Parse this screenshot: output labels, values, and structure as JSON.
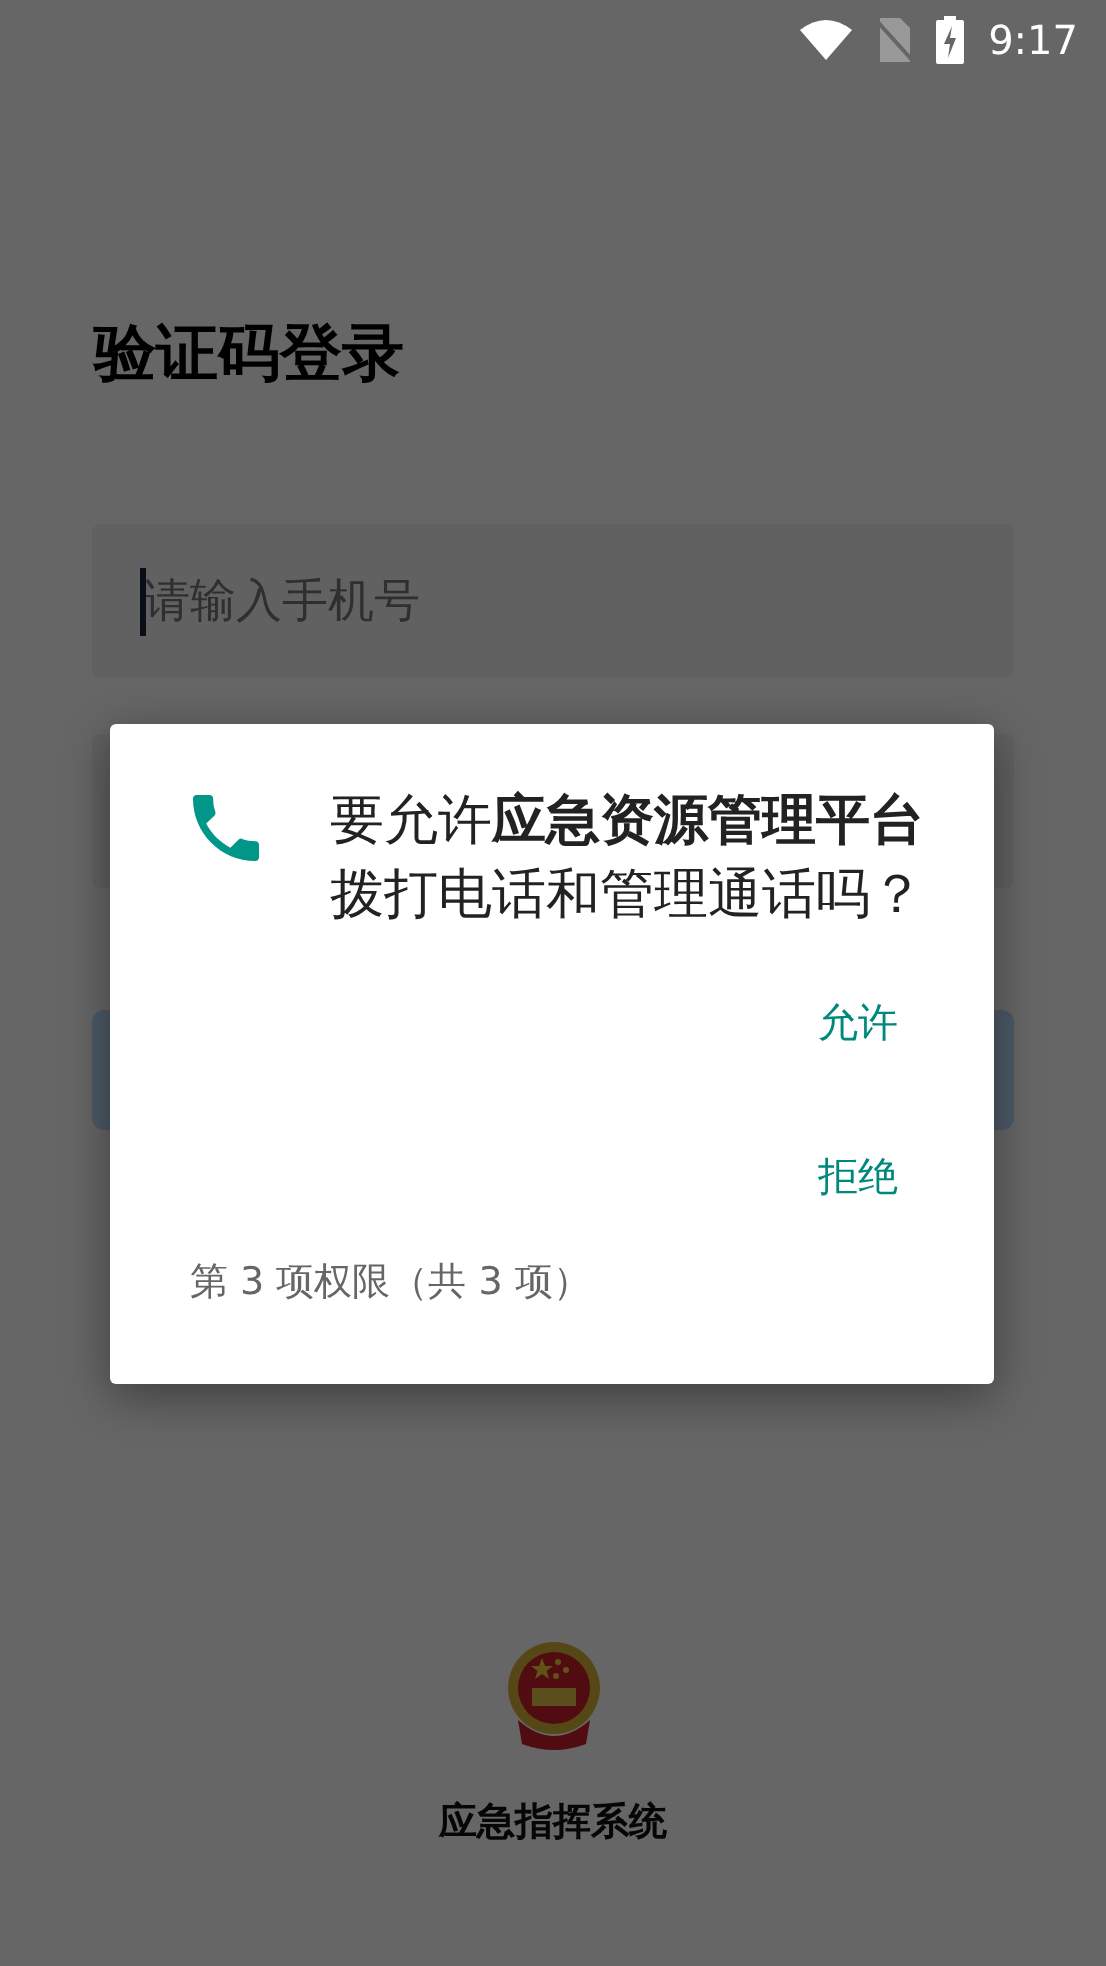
{
  "status_bar": {
    "time": "9:17"
  },
  "page": {
    "title": "验证码登录",
    "phone_field": {
      "placeholder": "请输入手机号",
      "focused": true
    },
    "caption": "应急指挥系统"
  },
  "dialog": {
    "message": "要允许**应急资源管理平台**拨打电话和管理通话吗？",
    "actions": [
      {
        "label": "允许"
      },
      {
        "label": "拒绝"
      }
    ],
    "footer": "第 3 项权限（共 3 项）"
  }
}
